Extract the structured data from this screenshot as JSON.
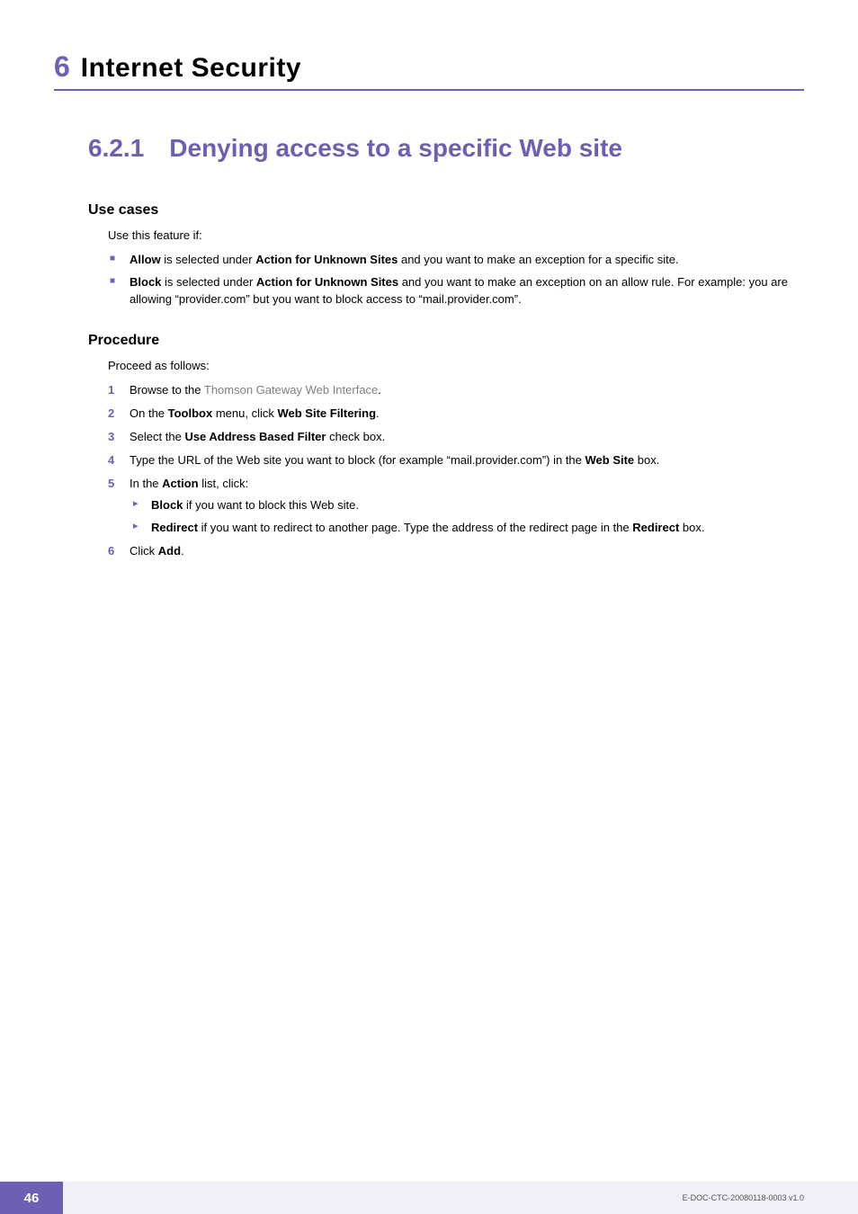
{
  "chapter": {
    "number": "6",
    "title": "Internet Security"
  },
  "section": {
    "number": "6.2.1",
    "title": "Denying access to a specific Web site"
  },
  "usecases": {
    "heading": "Use cases",
    "intro": "Use this feature if:",
    "items": [
      {
        "lead": "Allow",
        "mid": " is selected under ",
        "bold2": "Action for Unknown Sites",
        "rest": " and you want to make an exception for a specific site."
      },
      {
        "lead": "Block",
        "mid": " is selected under ",
        "bold2": "Action for Unknown Sites",
        "rest": " and you want to make an exception on an allow rule. For example: you are allowing “provider.com” but you want to block access to “mail.provider.com”."
      }
    ]
  },
  "procedure": {
    "heading": "Procedure",
    "intro": "Proceed as follows:",
    "steps": {
      "s1": {
        "num": "1",
        "pre": "Browse to the ",
        "link": "Thomson Gateway Web Interface",
        "post": "."
      },
      "s2": {
        "num": "2",
        "pre": "On the ",
        "b1": "Toolbox",
        "mid": " menu, click ",
        "b2": "Web Site Filtering",
        "post": "."
      },
      "s3": {
        "num": "3",
        "pre": "Select the ",
        "b1": "Use Address Based Filter",
        "post": " check box."
      },
      "s4": {
        "num": "4",
        "pre": "Type the URL of the Web site you want to block (for example “mail.provider.com”) in the ",
        "b1": "Web Site",
        "post": " box."
      },
      "s5": {
        "num": "5",
        "pre": "In the ",
        "b1": "Action",
        "post": " list, click:",
        "sub": [
          {
            "b": "Block",
            "rest": " if you want to block this Web site."
          },
          {
            "b": "Redirect",
            "rest": " if you want to redirect to another page. Type the address of the redirect page in the ",
            "b2": "Redirect",
            "rest2": " box."
          }
        ]
      },
      "s6": {
        "num": "6",
        "pre": "Click ",
        "b1": "Add",
        "post": "."
      }
    }
  },
  "footer": {
    "page": "46",
    "docref": "E-DOC-CTC-20080118-0003 v1.0"
  }
}
